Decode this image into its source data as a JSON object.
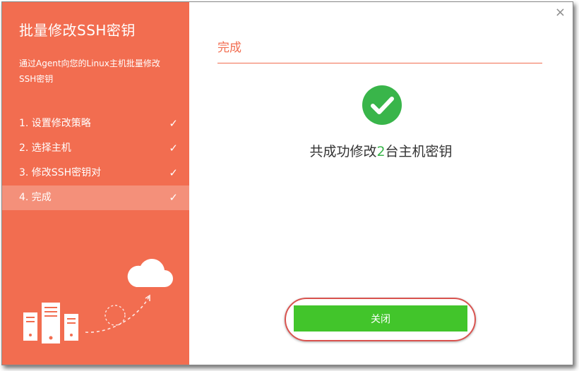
{
  "sidebar": {
    "title": "批量修改SSH密钥",
    "desc": "通过Agent向您的Linux主机批量修改SSH密钥",
    "steps": [
      {
        "label": "1. 设置修改策略",
        "check": "✓"
      },
      {
        "label": "2. 选择主机",
        "check": "✓"
      },
      {
        "label": "3. 修改SSH密钥对",
        "check": "✓"
      },
      {
        "label": "4. 完成",
        "check": "✓"
      }
    ]
  },
  "main": {
    "close_glyph": "×",
    "section_title": "完成",
    "result_prefix": "共成功修改",
    "result_count": "2",
    "result_suffix": "台主机密钥",
    "close_button": "关闭"
  },
  "colors": {
    "sidebar_bg": "#f26d50",
    "active_step_bg": "#f4907a",
    "accent": "#f26d50",
    "success": "#39b54a",
    "button": "#42c52b"
  }
}
